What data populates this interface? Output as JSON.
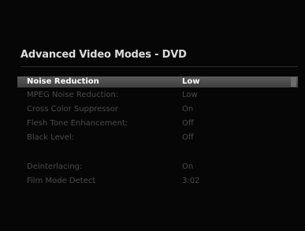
{
  "menu": {
    "title": "Advanced Video Modes - DVD",
    "settings": [
      {
        "label": "Noise Reduction",
        "value": "Low"
      },
      {
        "label": "MPEG Noise Reduction:",
        "value": "Low"
      },
      {
        "label": "Cross Color Suppressor",
        "value": "On"
      },
      {
        "label": "Flesh Tone Enhancement:",
        "value": "Off"
      },
      {
        "label": "Black Level:",
        "value": "Off"
      },
      {
        "label": "Deinterlacing:",
        "value": "On"
      },
      {
        "label": "Film Mode Detect",
        "value": "3:02"
      }
    ]
  },
  "colors": {
    "background": "#060606",
    "selected_row": "#4c4c4c",
    "dim_text": "#4b4b4b"
  }
}
